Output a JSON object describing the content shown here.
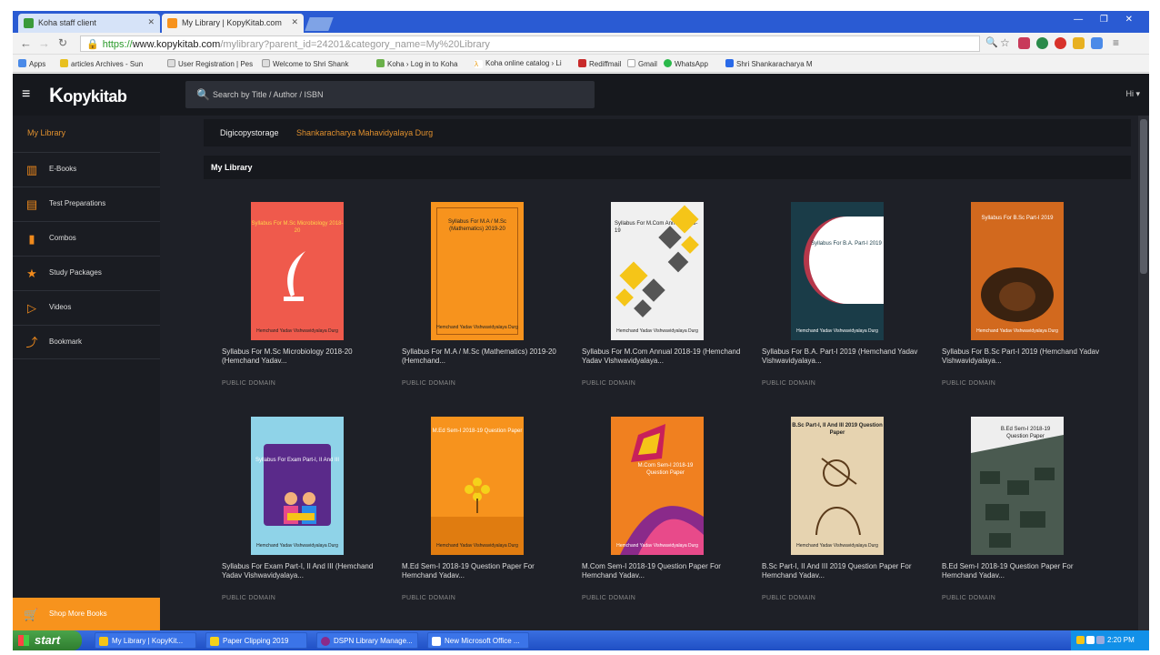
{
  "browser": {
    "tabs": [
      {
        "label": "Koha staff client",
        "active": false
      },
      {
        "label": "My Library | KopyKitab.com",
        "active": true
      }
    ],
    "url": {
      "scheme": "https://",
      "host": "www.kopykitab.com",
      "path": "/mylibrary?parent_id=24201&category_name=My%20Library"
    },
    "bookmarks": [
      "Apps",
      "articles Archives - Sun",
      "User Registration | Pes",
      "Welcome to Shri Shank",
      "Koha › Log in to Koha",
      "Koha online catalog › Li",
      "Rediffmail",
      "Gmail",
      "WhatsApp",
      "Shri Shankaracharya M"
    ]
  },
  "app": {
    "logo": "opykitab",
    "logo_initial": "K",
    "search_placeholder": "Search by Title / Author / ISBN",
    "user_menu": "Hi ▾",
    "sidebar": {
      "title": "My Library",
      "items": [
        {
          "label": "E-Books",
          "icon": "book-icon"
        },
        {
          "label": "Test Preparations",
          "icon": "test-icon"
        },
        {
          "label": "Combos",
          "icon": "combo-icon"
        },
        {
          "label": "Study Packages",
          "icon": "star-icon"
        },
        {
          "label": "Videos",
          "icon": "play-icon"
        },
        {
          "label": "Bookmark",
          "icon": "bookmark-icon"
        }
      ],
      "shop_button": "Shop More Books"
    },
    "breadcrumb": [
      "Digicopystorage",
      "Shankaracharya Mahavidyalaya Durg"
    ],
    "section_title": "My Library",
    "books": [
      {
        "title": "Syllabus For M.Sc Microbiology 2018-20 (Hemchand Yadav...",
        "license": "PUBLIC DOMAIN",
        "cover_title": "Syllabus For M.Sc Microbiology 2018-20",
        "cover_footer": "Hemchand Yadav Vishwavidyalaya Durg",
        "color": "#ef5a4c"
      },
      {
        "title": "Syllabus For M.A / M.Sc (Mathematics) 2019-20 (Hemchand...",
        "license": "PUBLIC DOMAIN",
        "cover_title": "Syllabus For M.A / M.Sc (Mathematics) 2019-20",
        "cover_footer": "Hemchand Yadav Vishwavidyalaya Durg",
        "color": "#f7931d"
      },
      {
        "title": "Syllabus For M.Com Annual 2018-19 (Hemchand Yadav Vishwavidyalaya...",
        "license": "PUBLIC DOMAIN",
        "cover_title": "Syllabus For M.Com Annual 2018-19",
        "cover_footer": "Hemchand Yadav Vishwavidyalaya Durg",
        "color": "#f0f0f0"
      },
      {
        "title": "Syllabus For B.A. Part-I 2019 (Hemchand Yadav Vishwavidyalaya...",
        "license": "PUBLIC DOMAIN",
        "cover_title": "Syllabus For B.A. Part-I 2019",
        "cover_footer": "Hemchand Yadav Vishwavidyalaya Durg",
        "color": "#1a3c48"
      },
      {
        "title": "Syllabus For B.Sc Part-I 2019 (Hemchand Yadav Vishwavidyalaya...",
        "license": "PUBLIC DOMAIN",
        "cover_title": "Syllabus For B.Sc Part-I 2019",
        "cover_footer": "Hemchand Yadav Vishwavidyalaya Durg",
        "color": "#d2691e"
      },
      {
        "title": "Syllabus For Exam Part-I, II And III (Hemchand Yadav Vishwavidyalaya...",
        "license": "PUBLIC DOMAIN",
        "cover_title": "Syllabus For Exam Part-I, II And III",
        "cover_footer": "Hemchand Yadav Vishwavidyalaya Durg",
        "color": "#8fd3e8"
      },
      {
        "title": "M.Ed Sem-I 2018-19 Question Paper For Hemchand Yadav...",
        "license": "PUBLIC DOMAIN",
        "cover_title": "M.Ed Sem-I 2018-19 Question Paper",
        "cover_footer": "Hemchand Yadav Vishwavidyalaya Durg",
        "color": "#f7931d"
      },
      {
        "title": "M.Com Sem-I 2018-19 Question Paper For Hemchand Yadav...",
        "license": "PUBLIC DOMAIN",
        "cover_title": "M.Com Sem-I 2018-19 Question Paper",
        "cover_footer": "Hemchand Yadav Vishwavidyalaya Durg",
        "color": "#f08020"
      },
      {
        "title": "B.Sc Part-I, II And III 2019 Question Paper For Hemchand Yadav...",
        "license": "PUBLIC DOMAIN",
        "cover_title": "B.Sc Part-I, II And III 2019 Question Paper",
        "cover_footer": "Hemchand Yadav Vishwavidyalaya Durg",
        "color": "#e6d3b0"
      },
      {
        "title": "B.Ed Sem-I 2018-19 Question Paper For Hemchand Yadav...",
        "license": "PUBLIC DOMAIN",
        "cover_title": "B.Ed Sem-I 2018-19 Question Paper",
        "cover_footer": "Hemchand Yadav Vishwavidyalaya Durg",
        "color": "#9aa8a0"
      }
    ]
  },
  "taskbar": {
    "start": "start",
    "tasks": [
      "My Library | KopyKit...",
      "Paper Clipping 2019",
      "DSPN Library Manage...",
      "New Microsoft Office ..."
    ],
    "clock": "2:20 PM"
  }
}
